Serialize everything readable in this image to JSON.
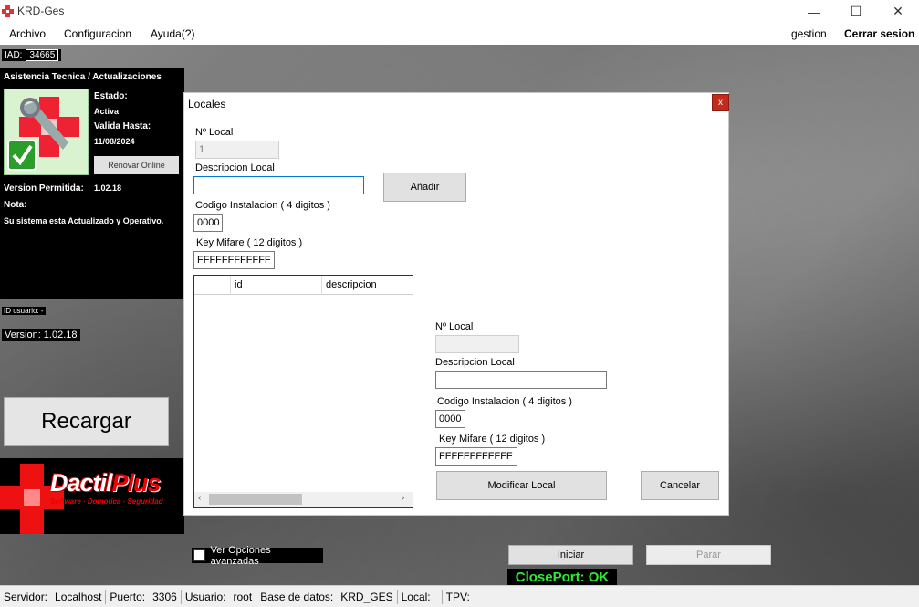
{
  "window": {
    "title": "KRD-Ges",
    "minimize": "—",
    "maximize": "☐",
    "close": "✕"
  },
  "menu": {
    "items": [
      "Archivo",
      "Configuracion",
      "Ayuda(?)"
    ],
    "user": "gestion",
    "logout": "Cerrar sesion"
  },
  "iad": {
    "label": "IAD:",
    "value": "34665"
  },
  "panel": {
    "title": "Asistencia Tecnica / Actualizaciones",
    "estado_label": "Estado:",
    "estado_value": "Activa",
    "valida_label": "Valida Hasta:",
    "valida_value": "11/08/2024",
    "renovar": "Renovar Online",
    "version_label": "Version Permitida:",
    "version_value": "1.02.18",
    "nota_label": "Nota:",
    "nota_value": "Su sistema esta Actualizado y Operativo."
  },
  "id_usuario": "ID usuario: -",
  "version_badge": "Version:  1.02.18",
  "recargar": "Recargar",
  "logo": {
    "brand": "Dactil",
    "brand_plus": "Plus",
    "tagline": "Software · Domotica · Seguridad"
  },
  "ver_opciones": "Ver Opciones avanzadas",
  "iniciar": "Iniciar",
  "parar": "Parar",
  "closeport": "ClosePort: OK",
  "status": {
    "servidor_label": "Servidor:",
    "servidor": "Localhost",
    "puerto_label": "Puerto:",
    "puerto": "3306",
    "usuario_label": "Usuario:",
    "usuario": "root",
    "bd_label": "Base de datos:",
    "bd": "KRD_GES",
    "local_label": "Local:",
    "local": "",
    "tpv_label": "TPV:",
    "tpv": ""
  },
  "dialog": {
    "title": "Locales",
    "close": "x",
    "left": {
      "nlocal_label": "Nº Local",
      "nlocal_value": "1",
      "desc_label": "Descripcion Local",
      "desc_value": "",
      "codigo_label": "Codigo Instalacion ( 4 digitos )",
      "codigo_value": "0000",
      "key_label": "Key Mifare ( 12 digitos )",
      "key_value": "FFFFFFFFFFFF"
    },
    "add_button": "Añadir",
    "grid": {
      "columns": [
        "",
        "id",
        "descripcion"
      ],
      "rows": []
    },
    "right": {
      "nlocal_label": "Nº Local",
      "nlocal_value": "",
      "desc_label": "Descripcion Local",
      "desc_value": "",
      "codigo_label": "Codigo Instalacion ( 4 digitos )",
      "codigo_value": "0000",
      "key_label": "Key Mifare ( 12 digitos )",
      "key_value": "FFFFFFFFFFFF"
    },
    "modify_button": "Modificar Local",
    "cancel_button": "Cancelar"
  }
}
